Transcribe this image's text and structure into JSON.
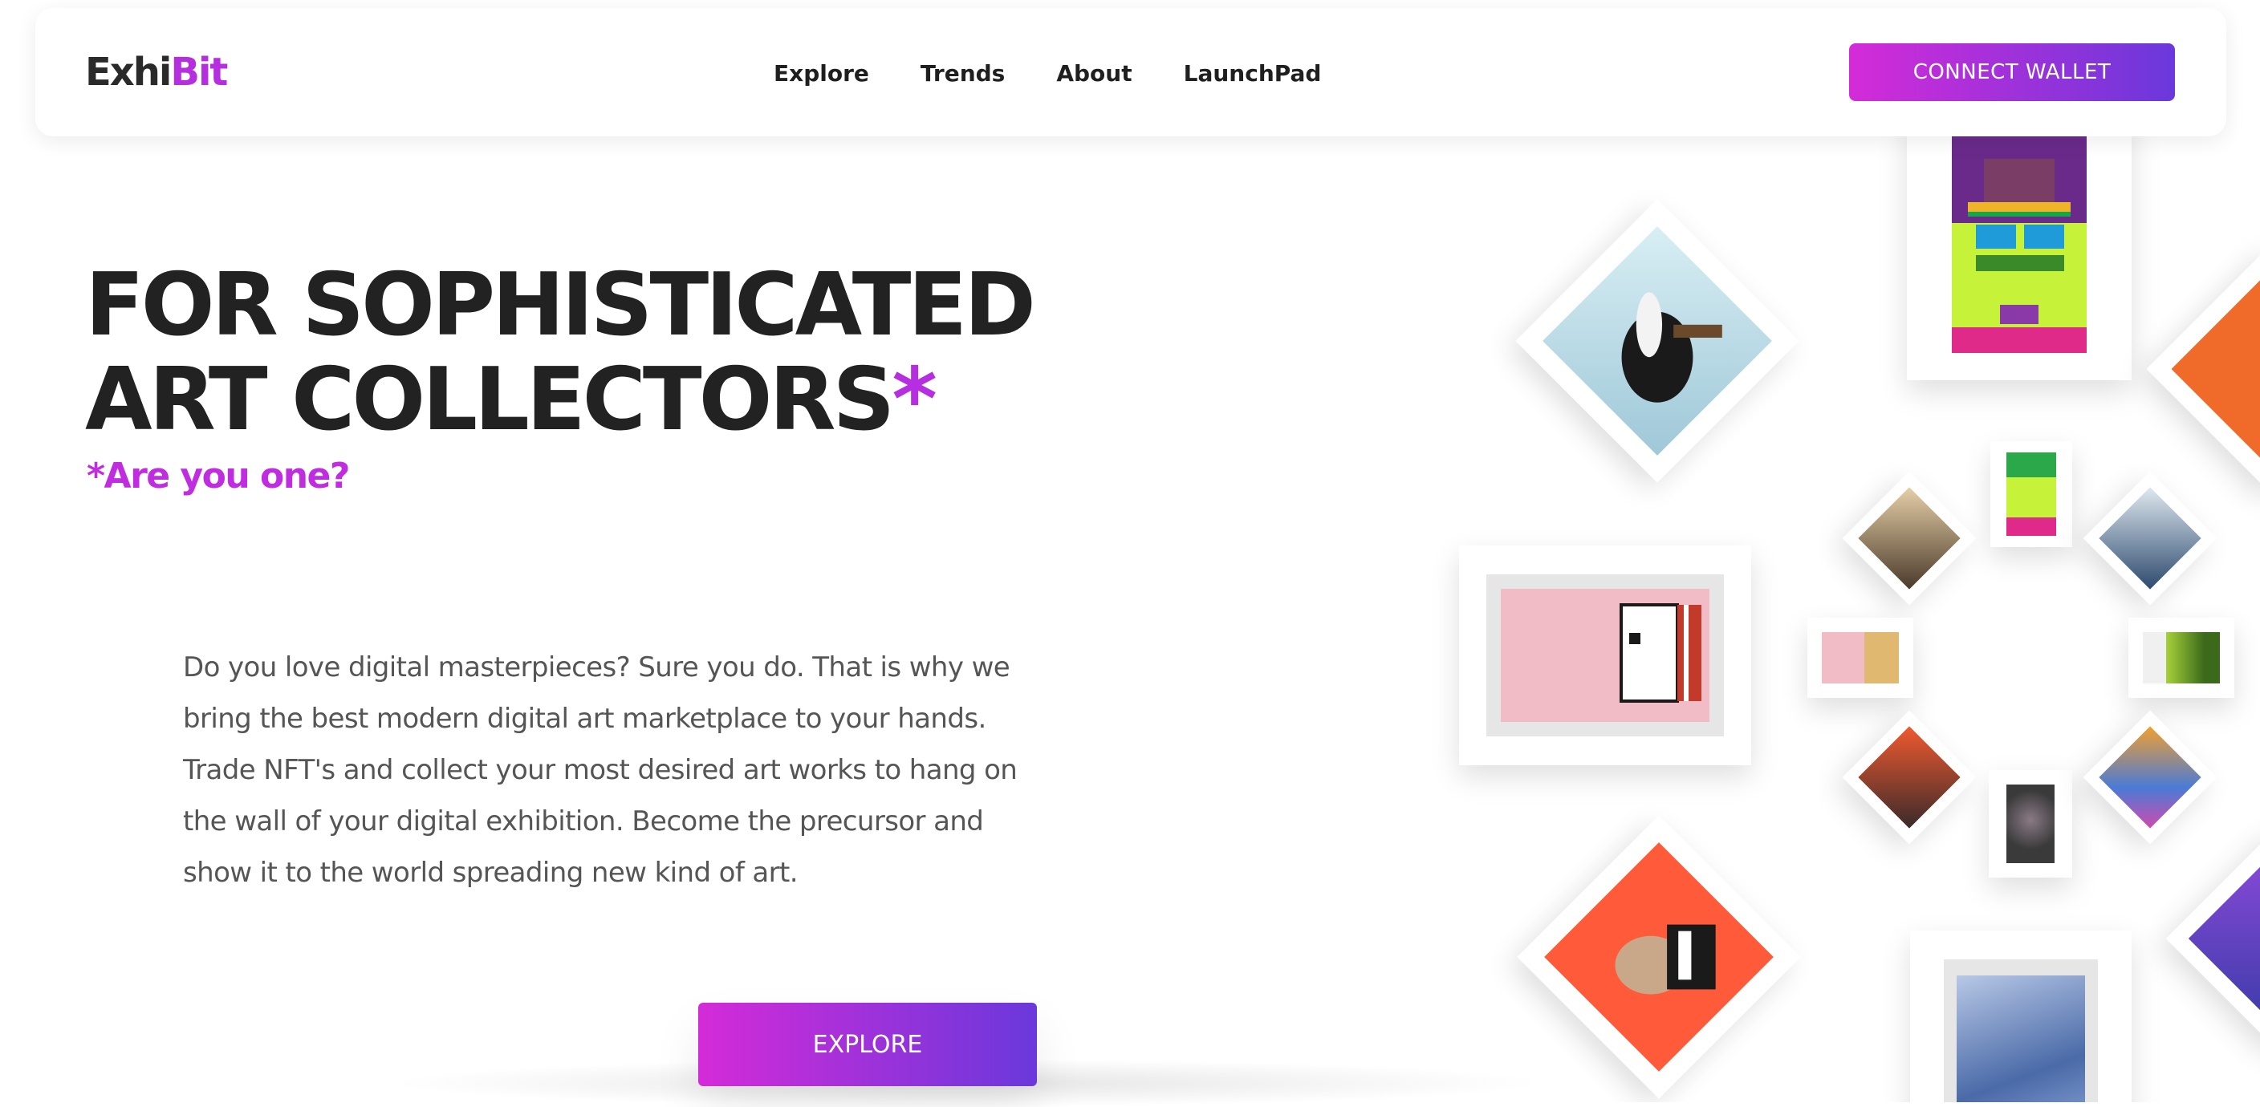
{
  "brand": {
    "logo_part1": "Exhi",
    "logo_part2": "Bit"
  },
  "nav": {
    "links": [
      "Explore",
      "Trends",
      "About",
      "LaunchPad"
    ],
    "connect_label": "CONNECT WALLET"
  },
  "hero": {
    "title_line1": "FOR SOPHISTICATED",
    "title_line2": "ART COLLECTORS",
    "title_asterisk": "*",
    "subtitle": "*Are you one?",
    "description": "Do you love digital masterpieces? Sure you do. That is why we bring the best modern digital art marketplace to your hands. Trade NFT's and collect your most desired art works to hang on the wall of your digital exhibition. Become the precursor and show it to the world spreading new kind of art.",
    "explore_label": "EXPLORE"
  },
  "colors": {
    "accent": "#c02ce0",
    "gradient_start": "#d42bd8",
    "gradient_end": "#6a38db",
    "text_dark": "#222222",
    "text_body": "#555555"
  },
  "gallery": {
    "artworks": [
      {
        "name": "gallery-artwork-pixel-character",
        "bg": "#c6f23a"
      },
      {
        "name": "gallery-artwork-skunk",
        "bg": "#cfe6ee"
      },
      {
        "name": "gallery-artwork-orange-edge",
        "bg": "#f06a2a"
      },
      {
        "name": "gallery-artwork-pink-pixel",
        "bg": "#f1bcc6"
      },
      {
        "name": "gallery-artwork-small-pixel",
        "bg": "#1e1e5a"
      },
      {
        "name": "gallery-artwork-small-figure",
        "bg": "#d9b892"
      },
      {
        "name": "gallery-artwork-small-blue",
        "bg": "#2d4a6e"
      },
      {
        "name": "gallery-artwork-small-pink",
        "bg": "#f1bcc6"
      },
      {
        "name": "gallery-artwork-small-green",
        "bg": "#a7d13a"
      },
      {
        "name": "gallery-artwork-small-orange",
        "bg": "#f05a30"
      },
      {
        "name": "gallery-artwork-small-dark",
        "bg": "#3a3a3a"
      },
      {
        "name": "gallery-artwork-small-colorful",
        "bg": "#4a7bd6"
      },
      {
        "name": "gallery-artwork-sloth",
        "bg": "#ff5a3a"
      },
      {
        "name": "gallery-artwork-blue-abstract",
        "bg": "#6e90c8"
      },
      {
        "name": "gallery-artwork-purple-edge",
        "bg": "#3b3ba8"
      }
    ]
  }
}
